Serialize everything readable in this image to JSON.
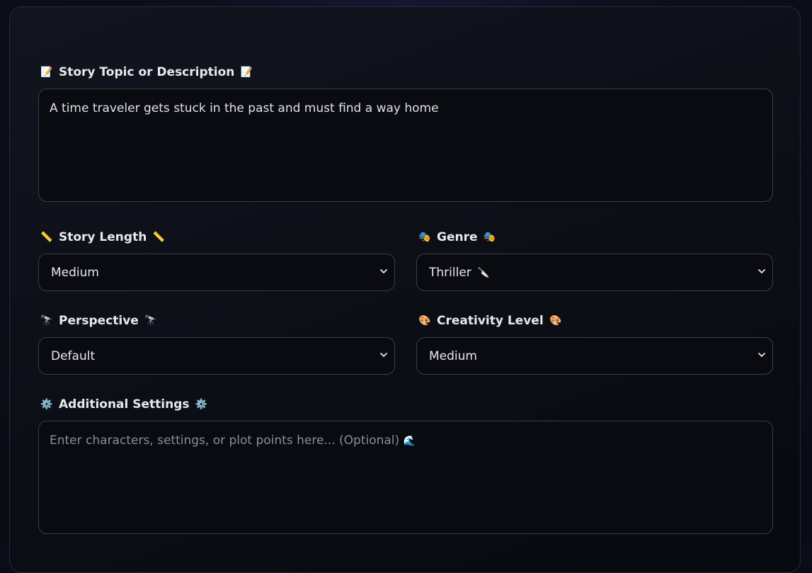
{
  "fields": {
    "topic": {
      "label": "Story Topic or Description",
      "icon": "memo-icon",
      "icon_glyph": "📝",
      "value": "A time traveler gets stuck in the past and must find a way home"
    },
    "length": {
      "label": "Story Length",
      "icon": "ruler-icon",
      "icon_glyph": "📏",
      "selected": "Medium"
    },
    "genre": {
      "label": "Genre",
      "icon": "theater-masks-icon",
      "icon_glyph": "🎭",
      "selected": "Thriller",
      "selected_icon_glyph": "🔪"
    },
    "perspective": {
      "label": "Perspective",
      "icon": "telescope-icon",
      "icon_glyph": "🔭",
      "selected": "Default"
    },
    "creativity": {
      "label": "Creativity Level",
      "icon": "palette-icon",
      "icon_glyph": "🎨",
      "selected": "Medium"
    },
    "additional": {
      "label": "Additional Settings",
      "icon": "gear-icon",
      "icon_glyph": "⚙️",
      "placeholder": "Enter characters, settings, or plot points here... (Optional)",
      "placeholder_icon_glyph": "🌊"
    }
  }
}
